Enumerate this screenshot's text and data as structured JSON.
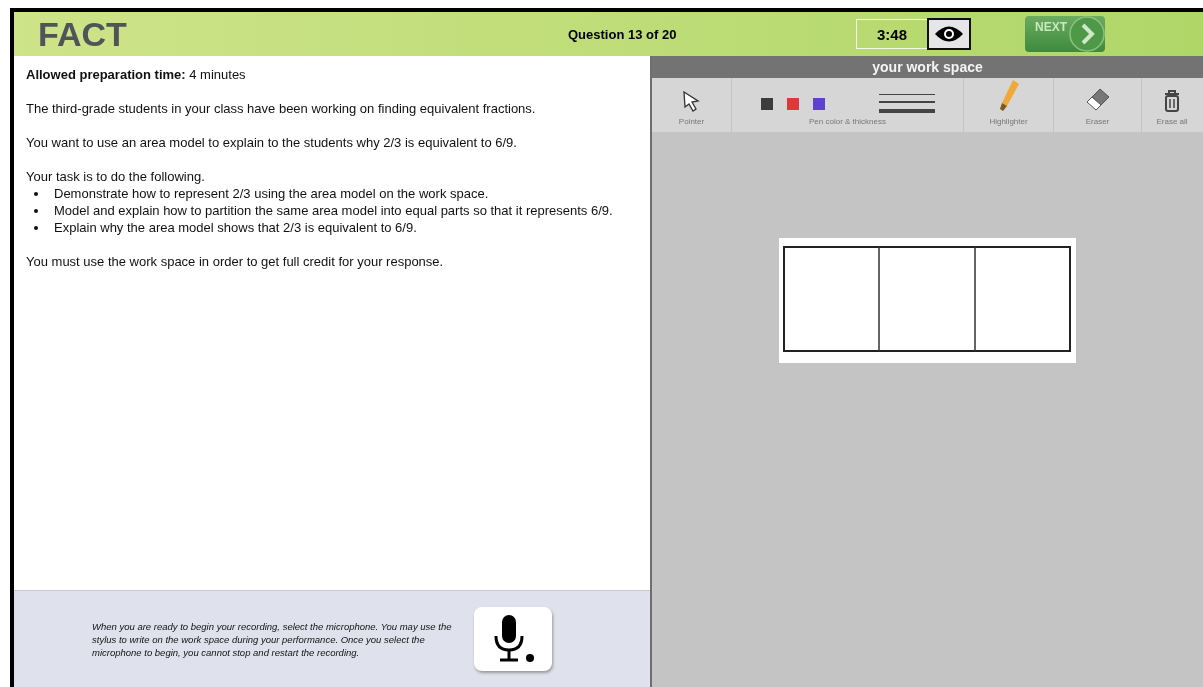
{
  "header": {
    "logo": "FACT",
    "question": "Question 13 of 20",
    "timer": "3:48",
    "next_button": "NEXT"
  },
  "task": {
    "prep": "**Allowed preparation time:** 4 minutes",
    "paragraphs": [
      "The third-grade students in your class have been working on finding equivalent fractions.",
      "You want to use an area model to explain to the students why 2/3 is equivalent to 6/9."
    ],
    "intro": "Your task is to do the following.",
    "bullets": [
      "Demonstrate how to represent 2/3 using the area model on the work space.",
      "Model and explain how to partition the same area model into equal parts so that it represents 6/9.",
      "Explain why the area model shows that 2/3 is equivalent to 6/9."
    ],
    "closing": "You must use the work space in order to get full credit for your response."
  },
  "recording": {
    "instructions": "When you are ready to begin your recording, select the microphone. You may use the stylus to write on the work space during your performance. Once you select the microphone to begin, you cannot stop and restart the recording."
  },
  "work_space": {
    "title": "your work space",
    "tools": [
      {
        "kind": "pointer",
        "label": "Pointer"
      },
      {
        "kind": "pen",
        "label": "Pen color & thickness",
        "colors": [
          {
            "color": "#3c3c3c"
          },
          {
            "color": "#e03838"
          },
          {
            "color": "#6040d0"
          }
        ]
      },
      {
        "kind": "highlighter",
        "label": "Highlighter"
      },
      {
        "kind": "eraser",
        "label": "Eraser"
      },
      {
        "kind": "erase_all",
        "label": "Erase all"
      }
    ]
  }
}
